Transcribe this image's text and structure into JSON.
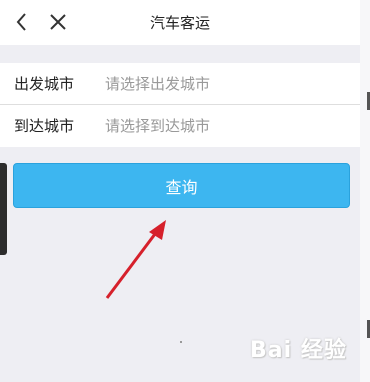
{
  "header": {
    "title": "汽车客运",
    "back_icon": "chevron-left-icon",
    "close_icon": "close-icon"
  },
  "form": {
    "departure_label": "出发城市",
    "departure_placeholder": "请选择出发城市",
    "arrival_label": "到达城市",
    "arrival_placeholder": "请选择到达城市"
  },
  "actions": {
    "query_label": "查询"
  },
  "watermark": "Bai 经验",
  "colors": {
    "accent": "#3db6f0",
    "arrow": "#d6202b"
  }
}
